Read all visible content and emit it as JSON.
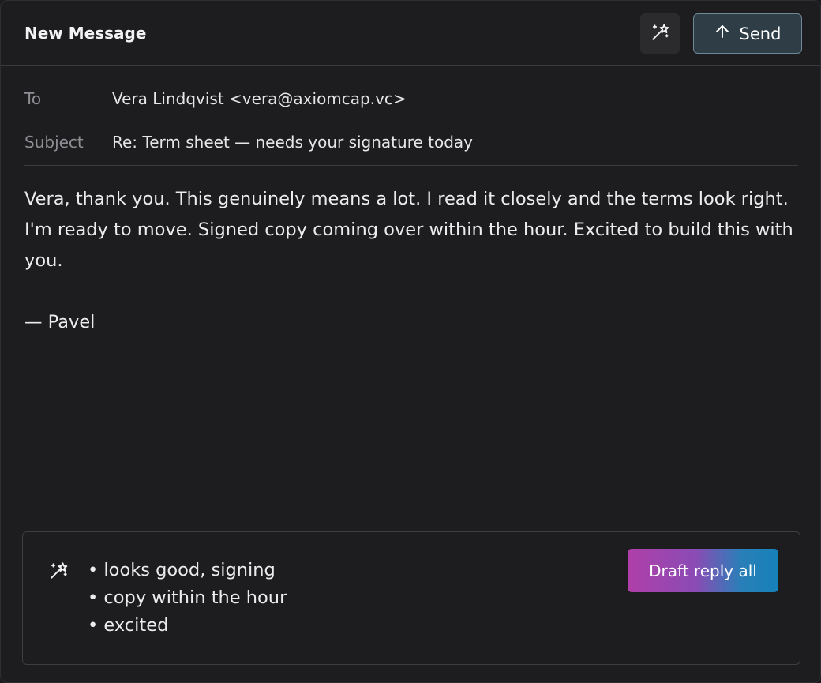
{
  "header": {
    "title": "New Message",
    "magic_icon": "magic-wand-icon",
    "send_icon": "arrow-up-icon",
    "send_label": "Send"
  },
  "fields": {
    "to_label": "To",
    "to_value": "Vera Lindqvist <vera@axiomcap.vc>",
    "subject_label": "Subject",
    "subject_value": "Re: Term sheet — needs your signature today"
  },
  "body": {
    "paragraph": "Vera, thank you. This genuinely means a lot. I read it closely and the terms look right. I'm ready to move. Signed copy coming over within the hour. Excited to build this with you.",
    "signature": "— Pavel"
  },
  "ai_panel": {
    "icon": "magic-wand-icon",
    "bullets": [
      "• looks good, signing",
      "• copy within the hour",
      "• excited"
    ],
    "draft_button_label": "Draft reply all"
  },
  "colors": {
    "background": "#1d1d1f",
    "send_button_bg": "#2f3d47",
    "send_button_border": "#6f8897",
    "draft_gradient_start": "#b03fa8",
    "draft_gradient_end": "#1681b9"
  }
}
